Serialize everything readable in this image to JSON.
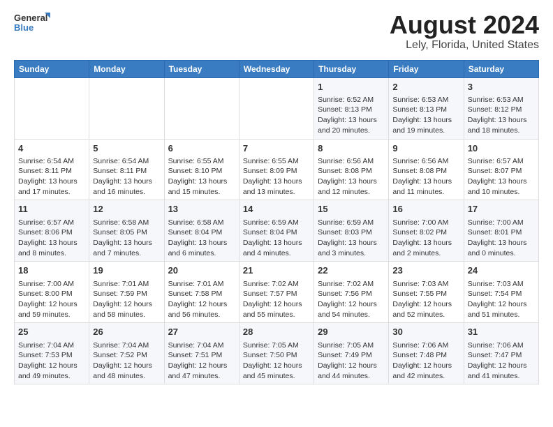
{
  "header": {
    "logo_line1": "General",
    "logo_line2": "Blue",
    "title": "August 2024",
    "subtitle": "Lely, Florida, United States"
  },
  "columns": [
    "Sunday",
    "Monday",
    "Tuesday",
    "Wednesday",
    "Thursday",
    "Friday",
    "Saturday"
  ],
  "weeks": [
    [
      {
        "day": "",
        "info": ""
      },
      {
        "day": "",
        "info": ""
      },
      {
        "day": "",
        "info": ""
      },
      {
        "day": "",
        "info": ""
      },
      {
        "day": "1",
        "info": "Sunrise: 6:52 AM\nSunset: 8:13 PM\nDaylight: 13 hours\nand 20 minutes."
      },
      {
        "day": "2",
        "info": "Sunrise: 6:53 AM\nSunset: 8:13 PM\nDaylight: 13 hours\nand 19 minutes."
      },
      {
        "day": "3",
        "info": "Sunrise: 6:53 AM\nSunset: 8:12 PM\nDaylight: 13 hours\nand 18 minutes."
      }
    ],
    [
      {
        "day": "4",
        "info": "Sunrise: 6:54 AM\nSunset: 8:11 PM\nDaylight: 13 hours\nand 17 minutes."
      },
      {
        "day": "5",
        "info": "Sunrise: 6:54 AM\nSunset: 8:11 PM\nDaylight: 13 hours\nand 16 minutes."
      },
      {
        "day": "6",
        "info": "Sunrise: 6:55 AM\nSunset: 8:10 PM\nDaylight: 13 hours\nand 15 minutes."
      },
      {
        "day": "7",
        "info": "Sunrise: 6:55 AM\nSunset: 8:09 PM\nDaylight: 13 hours\nand 13 minutes."
      },
      {
        "day": "8",
        "info": "Sunrise: 6:56 AM\nSunset: 8:08 PM\nDaylight: 13 hours\nand 12 minutes."
      },
      {
        "day": "9",
        "info": "Sunrise: 6:56 AM\nSunset: 8:08 PM\nDaylight: 13 hours\nand 11 minutes."
      },
      {
        "day": "10",
        "info": "Sunrise: 6:57 AM\nSunset: 8:07 PM\nDaylight: 13 hours\nand 10 minutes."
      }
    ],
    [
      {
        "day": "11",
        "info": "Sunrise: 6:57 AM\nSunset: 8:06 PM\nDaylight: 13 hours\nand 8 minutes."
      },
      {
        "day": "12",
        "info": "Sunrise: 6:58 AM\nSunset: 8:05 PM\nDaylight: 13 hours\nand 7 minutes."
      },
      {
        "day": "13",
        "info": "Sunrise: 6:58 AM\nSunset: 8:04 PM\nDaylight: 13 hours\nand 6 minutes."
      },
      {
        "day": "14",
        "info": "Sunrise: 6:59 AM\nSunset: 8:04 PM\nDaylight: 13 hours\nand 4 minutes."
      },
      {
        "day": "15",
        "info": "Sunrise: 6:59 AM\nSunset: 8:03 PM\nDaylight: 13 hours\nand 3 minutes."
      },
      {
        "day": "16",
        "info": "Sunrise: 7:00 AM\nSunset: 8:02 PM\nDaylight: 13 hours\nand 2 minutes."
      },
      {
        "day": "17",
        "info": "Sunrise: 7:00 AM\nSunset: 8:01 PM\nDaylight: 13 hours\nand 0 minutes."
      }
    ],
    [
      {
        "day": "18",
        "info": "Sunrise: 7:00 AM\nSunset: 8:00 PM\nDaylight: 12 hours\nand 59 minutes."
      },
      {
        "day": "19",
        "info": "Sunrise: 7:01 AM\nSunset: 7:59 PM\nDaylight: 12 hours\nand 58 minutes."
      },
      {
        "day": "20",
        "info": "Sunrise: 7:01 AM\nSunset: 7:58 PM\nDaylight: 12 hours\nand 56 minutes."
      },
      {
        "day": "21",
        "info": "Sunrise: 7:02 AM\nSunset: 7:57 PM\nDaylight: 12 hours\nand 55 minutes."
      },
      {
        "day": "22",
        "info": "Sunrise: 7:02 AM\nSunset: 7:56 PM\nDaylight: 12 hours\nand 54 minutes."
      },
      {
        "day": "23",
        "info": "Sunrise: 7:03 AM\nSunset: 7:55 PM\nDaylight: 12 hours\nand 52 minutes."
      },
      {
        "day": "24",
        "info": "Sunrise: 7:03 AM\nSunset: 7:54 PM\nDaylight: 12 hours\nand 51 minutes."
      }
    ],
    [
      {
        "day": "25",
        "info": "Sunrise: 7:04 AM\nSunset: 7:53 PM\nDaylight: 12 hours\nand 49 minutes."
      },
      {
        "day": "26",
        "info": "Sunrise: 7:04 AM\nSunset: 7:52 PM\nDaylight: 12 hours\nand 48 minutes."
      },
      {
        "day": "27",
        "info": "Sunrise: 7:04 AM\nSunset: 7:51 PM\nDaylight: 12 hours\nand 47 minutes."
      },
      {
        "day": "28",
        "info": "Sunrise: 7:05 AM\nSunset: 7:50 PM\nDaylight: 12 hours\nand 45 minutes."
      },
      {
        "day": "29",
        "info": "Sunrise: 7:05 AM\nSunset: 7:49 PM\nDaylight: 12 hours\nand 44 minutes."
      },
      {
        "day": "30",
        "info": "Sunrise: 7:06 AM\nSunset: 7:48 PM\nDaylight: 12 hours\nand 42 minutes."
      },
      {
        "day": "31",
        "info": "Sunrise: 7:06 AM\nSunset: 7:47 PM\nDaylight: 12 hours\nand 41 minutes."
      }
    ]
  ]
}
